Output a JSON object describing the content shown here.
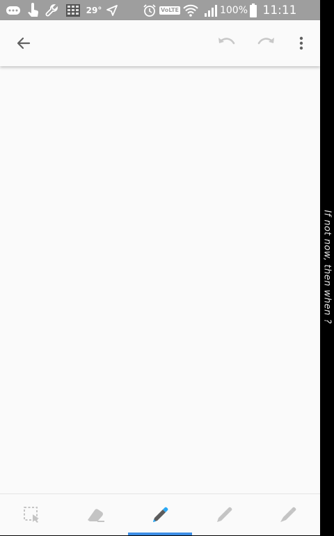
{
  "status_bar": {
    "temperature": "29°",
    "volte": "VoLTE",
    "battery_percent": "100%",
    "time": "11:11",
    "icons": [
      "message-icon",
      "touch-icon",
      "wrench-icon",
      "grid-icon",
      "send-icon",
      "alarm-icon",
      "volte-icon",
      "wifi-icon",
      "signal-icon",
      "battery-icon"
    ]
  },
  "toolbar": {
    "icons": [
      "back-arrow-icon",
      "undo-icon",
      "redo-icon",
      "more-vert-icon"
    ]
  },
  "bottom_tools": {
    "items": [
      "lasso-select",
      "eraser",
      "pen",
      "pencil",
      "marker"
    ],
    "active": "pen",
    "active_color": "#3d8ee5",
    "pen_tip_color": "#29a8f5"
  },
  "side_text": "If not now, then when ?"
}
